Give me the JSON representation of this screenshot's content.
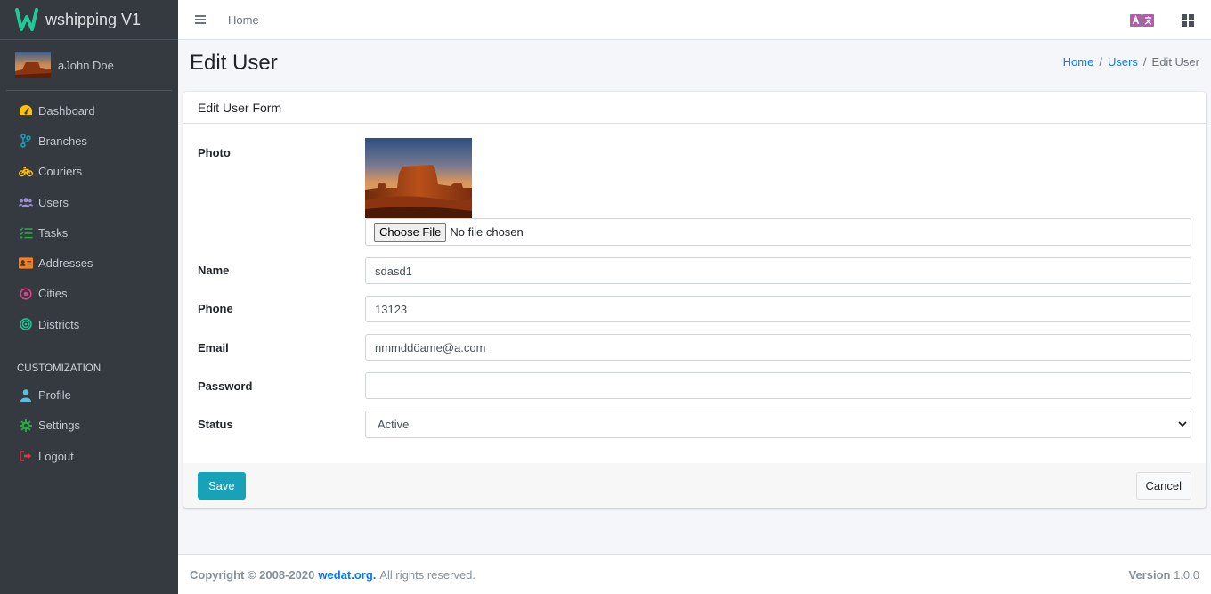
{
  "brand": {
    "name": "wshipping V1",
    "logo_icon": "w-logo-icon",
    "logo_letter": "W"
  },
  "user": {
    "name": "aJohn Doe"
  },
  "sidebar": {
    "items": [
      {
        "label": "Dashboard",
        "icon": "tachometer-icon",
        "color": "#ffc107"
      },
      {
        "label": "Branches",
        "icon": "code-branch-icon",
        "color": "#17a2b8"
      },
      {
        "label": "Couriers",
        "icon": "bicycle-icon",
        "color": "#ffc107"
      },
      {
        "label": "Users",
        "icon": "users-icon",
        "color": "#9b8fd6"
      },
      {
        "label": "Tasks",
        "icon": "tasks-icon",
        "color": "#28a745"
      },
      {
        "label": "Addresses",
        "icon": "address-card-icon",
        "color": "#fd7e14"
      },
      {
        "label": "Cities",
        "icon": "dot-circle-icon",
        "color": "#e83e8c"
      },
      {
        "label": "Districts",
        "icon": "bullseye-icon",
        "color": "#20c997"
      }
    ],
    "header": "CUSTOMIZATION",
    "custom_items": [
      {
        "label": "Profile",
        "icon": "user-icon",
        "color": "#5bc0de"
      },
      {
        "label": "Settings",
        "icon": "cog-icon",
        "color": "#28a745"
      },
      {
        "label": "Logout",
        "icon": "sign-out-icon",
        "color": "#dc3545"
      }
    ]
  },
  "navbar": {
    "home": "Home",
    "lang_icon": "language-icon",
    "lang_colors": "#b15dad",
    "grid_icon": "th-large-icon"
  },
  "page": {
    "title": "Edit User"
  },
  "breadcrumb": {
    "home": "Home",
    "users": "Users",
    "current": "Edit User",
    "separator": "/"
  },
  "form": {
    "card_title": "Edit User Form",
    "photo_label": "Photo",
    "file_button": "Choose File",
    "file_status": "No file chosen",
    "name_label": "Name",
    "name_value": "sdasd1",
    "phone_label": "Phone",
    "phone_value": "13123",
    "email_label": "Email",
    "email_value": "nmmddöame@a.com",
    "password_label": "Password",
    "password_value": "",
    "status_label": "Status",
    "status_value": "Active",
    "save_label": "Save",
    "cancel_label": "Cancel"
  },
  "footer": {
    "copyright": "Copyright © 2008-2020",
    "org_link": "wedat.org.",
    "rights": "All rights reserved.",
    "version_label": "Version",
    "version_number": "1.0.0"
  },
  "colors": {
    "accent": "#17a2b8",
    "link": "#007bff",
    "sidebar_bg": "#343a40"
  }
}
